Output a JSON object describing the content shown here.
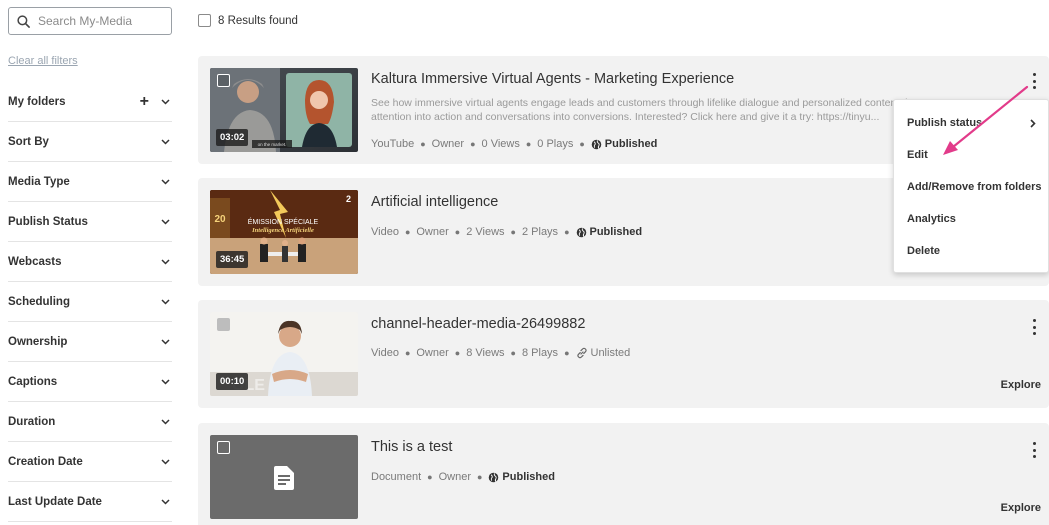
{
  "search": {
    "placeholder": "Search My-Media"
  },
  "sidebar": {
    "clear_filters": "Clear all filters",
    "filters": [
      {
        "label": "My folders",
        "has_plus": true
      },
      {
        "label": "Sort By"
      },
      {
        "label": "Media Type"
      },
      {
        "label": "Publish Status"
      },
      {
        "label": "Webcasts"
      },
      {
        "label": "Scheduling"
      },
      {
        "label": "Ownership"
      },
      {
        "label": "Captions"
      },
      {
        "label": "Duration"
      },
      {
        "label": "Creation Date"
      },
      {
        "label": "Last Update Date"
      }
    ]
  },
  "results": {
    "count_text": "8 Results found"
  },
  "media": [
    {
      "title": "Kaltura Immersive Virtual Agents - Marketing Experience",
      "description": "See how immersive virtual agents engage leads and customers through lifelike dialogue and personalized content tha... attention into action and conversations into conversions. Interested? Click here and give it a try: https://tinyu...",
      "duration": "03:02",
      "type": "YouTube",
      "owner": "Owner",
      "views": "0 Views",
      "plays": "0 Plays",
      "status": "Published",
      "status_icon": "globe-icon"
    },
    {
      "title": "Artificial intelligence",
      "duration": "36:45",
      "badge": "2",
      "type": "Video",
      "owner": "Owner",
      "views": "2 Views",
      "plays": "2 Plays",
      "status": "Published",
      "status_icon": "globe-icon"
    },
    {
      "title": "channel-header-media-26499882",
      "duration": "00:10",
      "type": "Video",
      "owner": "Owner",
      "views": "8 Views",
      "plays": "8 Plays",
      "status": "Unlisted",
      "status_icon": "link-icon",
      "explore": "Explore"
    },
    {
      "title": "This is a test",
      "type": "Document",
      "owner": "Owner",
      "status": "Published",
      "status_icon": "globe-icon",
      "explore": "Explore"
    }
  ],
  "menu": {
    "items": [
      "Publish status",
      "Edit",
      "Add/Remove from folders",
      "Analytics",
      "Delete"
    ]
  },
  "colors": {
    "accent_arrow": "#e23b8a",
    "card_bg": "#f2f2f2"
  }
}
